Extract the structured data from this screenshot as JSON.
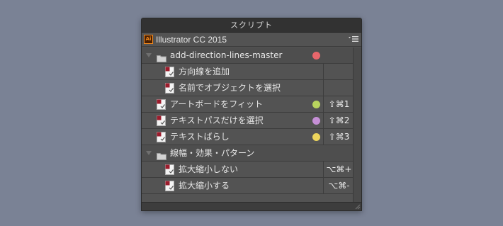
{
  "panel": {
    "title": "スクリプト",
    "app_name": "Illustrator CC 2015",
    "app_icon_text": "Ai"
  },
  "rows": [
    {
      "type": "group",
      "label": "add-direction-lines-master",
      "dot": "#e8666b"
    },
    {
      "type": "item",
      "indent": 2,
      "label": "方向線を追加",
      "key": ""
    },
    {
      "type": "item",
      "indent": 2,
      "label": "名前でオブジェクトを選択",
      "key": ""
    },
    {
      "type": "item",
      "indent": 1,
      "label": "アートボードをフィット",
      "dot": "#b8d45e",
      "key": "⇧⌘1"
    },
    {
      "type": "item",
      "indent": 1,
      "label": "テキストパスだけを選択",
      "dot": "#c58fd6",
      "key": "⇧⌘2"
    },
    {
      "type": "item",
      "indent": 1,
      "label": "テキストばらし",
      "dot": "#ecd45c",
      "key": "⇧⌘3"
    },
    {
      "type": "group",
      "label": "線幅・効果・パターン"
    },
    {
      "type": "item",
      "indent": 2,
      "label": "拡大縮小しない",
      "key": "⌥⌘+"
    },
    {
      "type": "item",
      "indent": 2,
      "label": "拡大縮小する",
      "key": "⌥⌘-"
    },
    {
      "type": "empty"
    }
  ],
  "colors": {
    "background": "#7a8295",
    "panel": "#535353",
    "accent_ai": "#f28a1e"
  }
}
